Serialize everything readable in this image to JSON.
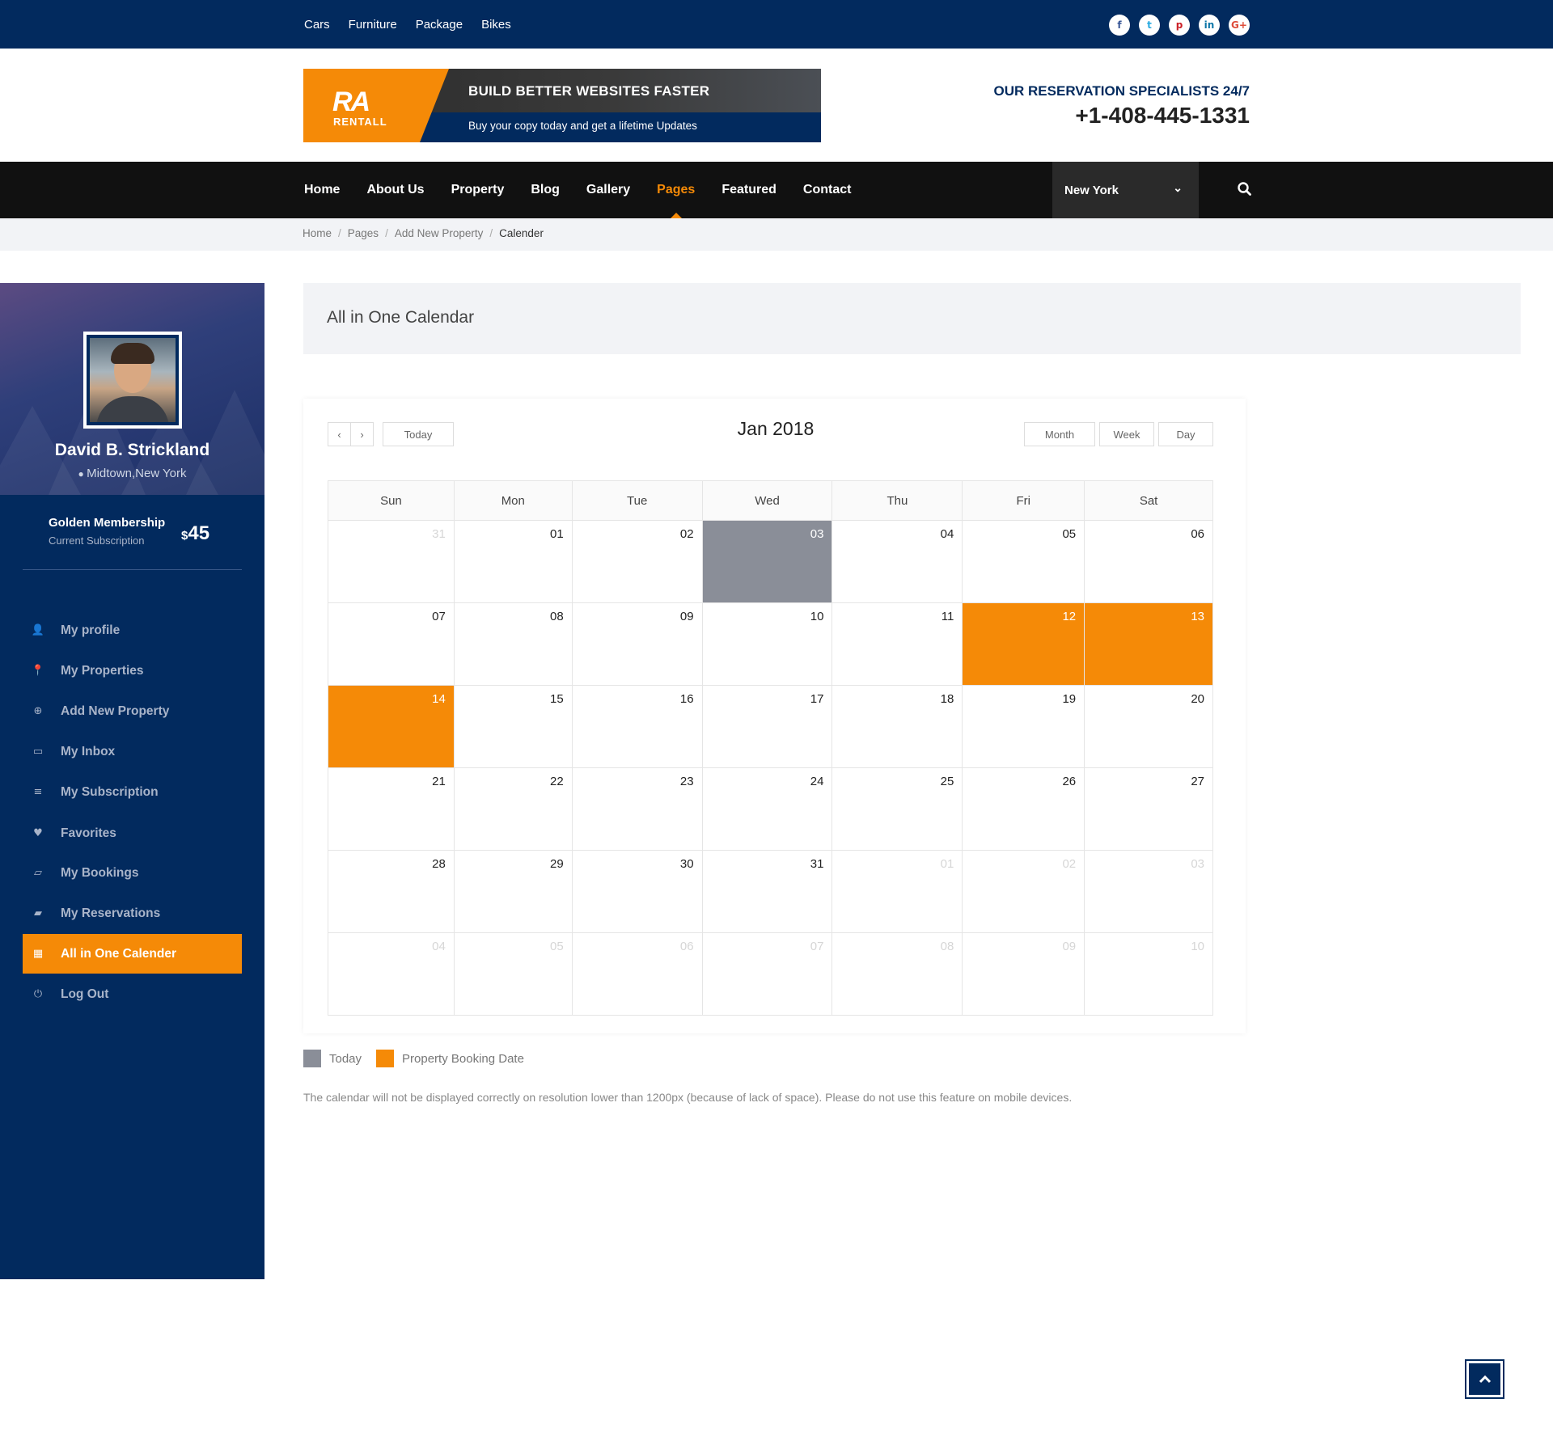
{
  "topbar": {
    "links": [
      "Cars",
      "Furniture",
      "Package",
      "Bikes"
    ],
    "social": [
      {
        "icon": "facebook-icon",
        "glyph": "f",
        "color": "#3b5998"
      },
      {
        "icon": "twitter-icon",
        "glyph": "t",
        "color": "#29aae1"
      },
      {
        "icon": "pinterest-icon",
        "glyph": "p",
        "color": "#cb2027"
      },
      {
        "icon": "linkedin-icon",
        "glyph": "in",
        "color": "#0e76a8"
      },
      {
        "icon": "google-plus-icon",
        "glyph": "G+",
        "color": "#dd4b39"
      }
    ]
  },
  "header": {
    "logo_mark": "RA",
    "logo_text": "RENTALL",
    "banner_title": "BUILD BETTER WEBSITES FASTER",
    "banner_subtitle": "Buy your copy today and get a lifetime Updates",
    "reservation_title": "OUR RESERVATION SPECIALISTS 24/7",
    "reservation_phone": "+1-408-445-1331"
  },
  "nav": {
    "items": [
      "Home",
      "About Us",
      "Property",
      "Blog",
      "Gallery",
      "Pages",
      "Featured",
      "Contact"
    ],
    "active": "Pages",
    "city": "New York",
    "search_icon": "search-icon"
  },
  "breadcrumb": [
    "Home",
    "Pages",
    "Add New Property",
    "Calender"
  ],
  "sidebar": {
    "name": "David B. Strickland",
    "location": "Midtown,New York",
    "membership_title": "Golden Membership",
    "membership_sub": "Current Subscription",
    "price_currency": "$",
    "price_value": "45",
    "menu": [
      {
        "label": "My profile",
        "icon": "user-icon",
        "glyph": "👤"
      },
      {
        "label": "My Properties",
        "icon": "map-marker-icon",
        "glyph": "📍"
      },
      {
        "label": "Add New Property",
        "icon": "plus-circle-icon",
        "glyph": "⊕"
      },
      {
        "label": "My Inbox",
        "icon": "inbox-icon",
        "glyph": "▭"
      },
      {
        "label": "My Subscription",
        "icon": "list-icon",
        "glyph": "≡"
      },
      {
        "label": "Favorites",
        "icon": "heart-icon",
        "glyph": "♥"
      },
      {
        "label": "My Bookings",
        "icon": "folder-open-icon",
        "glyph": "▱"
      },
      {
        "label": "My Reservations",
        "icon": "folder-icon",
        "glyph": "▰"
      },
      {
        "label": "All in One Calender",
        "icon": "calendar-icon",
        "glyph": "▦"
      },
      {
        "label": "Log Out",
        "icon": "power-icon",
        "glyph": "⏻"
      }
    ],
    "active_index": 8
  },
  "content": {
    "title": "All in One Calendar",
    "calendar": {
      "month_label": "Jan 2018",
      "today_button": "Today",
      "views": [
        "Month",
        "Week",
        "Day"
      ],
      "weekdays": [
        "Sun",
        "Mon",
        "Tue",
        "Wed",
        "Thu",
        "Fri",
        "Sat"
      ],
      "weeks": [
        [
          {
            "d": "31",
            "o": 1
          },
          {
            "d": "01"
          },
          {
            "d": "02"
          },
          {
            "d": "03",
            "t": "today"
          },
          {
            "d": "04"
          },
          {
            "d": "05"
          },
          {
            "d": "06"
          }
        ],
        [
          {
            "d": "07"
          },
          {
            "d": "08"
          },
          {
            "d": "09"
          },
          {
            "d": "10"
          },
          {
            "d": "11"
          },
          {
            "d": "12",
            "t": "booked"
          },
          {
            "d": "13",
            "t": "booked"
          }
        ],
        [
          {
            "d": "14",
            "t": "booked"
          },
          {
            "d": "15"
          },
          {
            "d": "16"
          },
          {
            "d": "17"
          },
          {
            "d": "18"
          },
          {
            "d": "19"
          },
          {
            "d": "20"
          }
        ],
        [
          {
            "d": "21"
          },
          {
            "d": "22"
          },
          {
            "d": "23"
          },
          {
            "d": "24"
          },
          {
            "d": "25"
          },
          {
            "d": "26"
          },
          {
            "d": "27"
          }
        ],
        [
          {
            "d": "28"
          },
          {
            "d": "29"
          },
          {
            "d": "30"
          },
          {
            "d": "31"
          },
          {
            "d": "01",
            "o": 1
          },
          {
            "d": "02",
            "o": 1
          },
          {
            "d": "03",
            "o": 1
          }
        ],
        [
          {
            "d": "04",
            "o": 1
          },
          {
            "d": "05",
            "o": 1
          },
          {
            "d": "06",
            "o": 1
          },
          {
            "d": "07",
            "o": 1
          },
          {
            "d": "08",
            "o": 1
          },
          {
            "d": "09",
            "o": 1
          },
          {
            "d": "10",
            "o": 1
          }
        ]
      ]
    },
    "legend": [
      {
        "label": "Today",
        "color": "#8a8e98"
      },
      {
        "label": "Property Booking Date",
        "color": "#f58a07"
      }
    ],
    "note": "The calendar will not be displayed correctly on resolution lower than 1200px (because of lack of space). Please do not use this feature on mobile devices."
  },
  "colors": {
    "navy": "#022a5e",
    "orange": "#f58a07",
    "today": "#8a8e98"
  }
}
